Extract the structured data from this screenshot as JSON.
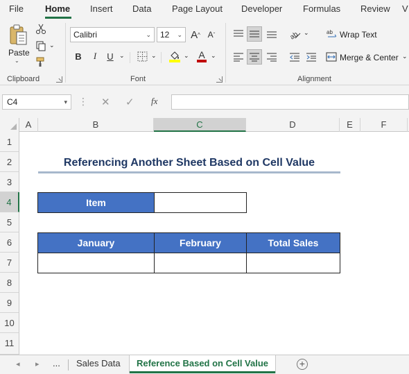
{
  "menu": {
    "items": [
      "File",
      "Home",
      "Insert",
      "Data",
      "Page Layout",
      "Developer",
      "Formulas",
      "Review",
      "V"
    ],
    "active": "Home"
  },
  "ribbon": {
    "clipboard": {
      "paste_label": "Paste",
      "group_label": "Clipboard"
    },
    "font": {
      "font_name": "Calibri",
      "font_size": "12",
      "group_label": "Font",
      "bold": "B",
      "italic": "I",
      "underline": "U"
    },
    "alignment": {
      "wrap_text": "Wrap Text",
      "merge_center": "Merge & Center",
      "group_label": "Alignment"
    },
    "colors": {
      "accent": "#217346",
      "highlight": "#ffff00",
      "font_color": "#c00000"
    }
  },
  "formula_bar": {
    "name_box": "C4",
    "fx_label": "fx",
    "formula": ""
  },
  "grid": {
    "columns": [
      "A",
      "B",
      "C",
      "D",
      "E",
      "F"
    ],
    "selected_column": "C",
    "rows": [
      "1",
      "2",
      "3",
      "4",
      "5",
      "6",
      "7",
      "8",
      "9",
      "10",
      "11"
    ],
    "selected_row": "4",
    "title": "Referencing Another Sheet Based on Cell Value",
    "item_label": "Item",
    "item_value": "",
    "table_headers": [
      "January",
      "February",
      "Total Sales"
    ],
    "table_values": [
      "",
      "",
      ""
    ],
    "header_fill": "#4472c4",
    "title_color": "#1f3864"
  },
  "sheet_tabs": {
    "overflow": "...",
    "tabs": [
      "Sales Data",
      "Reference Based on Cell Value"
    ],
    "active": "Reference Based on Cell Value"
  }
}
